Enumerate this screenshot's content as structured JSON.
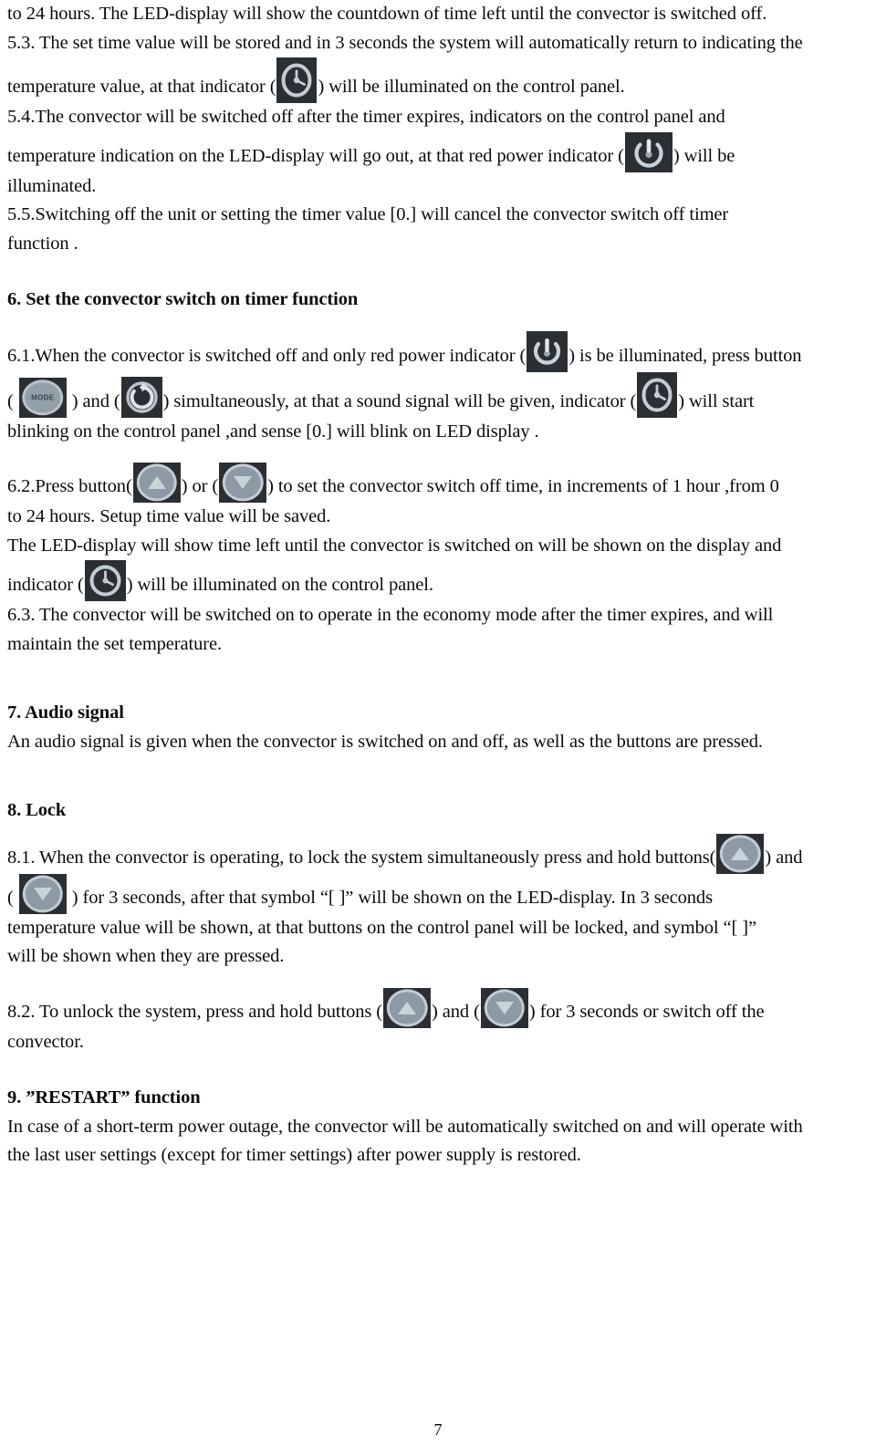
{
  "document": {
    "page_number": "7"
  },
  "icons": {
    "timer": "clock-timer-icon",
    "power": "power-icon",
    "mode": "mode-button-icon",
    "mode_label": "MODE",
    "restart": "restart-cycle-icon",
    "arrow_up": "arrow-up-button-icon",
    "arrow_down": "arrow-down-button-icon"
  },
  "colors": {
    "icon_background": "#2b2e33",
    "icon_glyph": "#c8d2d9",
    "icon_button_face": "#8d9aa5",
    "page_background": "#ffffff",
    "text": "#0b0b0b"
  },
  "body": {
    "p_top": "to 24 hours. The LED-display will show the countdown of time left until the convector is switched off.",
    "p_5_3_a": "5.3. The set time value will be stored and in 3 seconds the system will automatically return to indicating the",
    "p_5_3_b_pre": "temperature value, at that indicator (",
    "p_5_3_b_post": ") will be illuminated on the control panel.",
    "p_5_4_a": "5.4.The convector will be switched off after the timer expires, indicators on the control panel and",
    "p_5_4_b_pre": "temperature indication on the LED-display will go out, at that red power indicator (",
    "p_5_4_b_post": ") will be",
    "p_5_4_c": "illuminated.",
    "p_5_5_a": "5.5.Switching off the unit or setting the timer value   [0.] will cancel the convector switch off timer",
    "p_5_5_b": "function .",
    "h_6": "6. Set the convector switch on timer function",
    "p_6_1_a_pre": "6.1.When the convector is switched off and only red power indicator (",
    "p_6_1_a_post": ") is be illuminated, press button",
    "p_6_1_b_pre": "( ",
    "p_6_1_b_mid1": " ) and (",
    "p_6_1_b_mid2": ") simultaneously, at that a sound signal will be given, indicator (",
    "p_6_1_b_post": ") will start",
    "p_6_1_c": "blinking on the control panel ,and sense [0.]    will blink on LED display .",
    "p_6_2_pre": "6.2.Press button(",
    "p_6_2_mid": ") or (",
    "p_6_2_post": ") to set the convector switch off time, in increments of 1 hour ,from 0",
    "p_6_2_b": "to 24 hours. Setup time value will be saved.",
    "p_6_2_c": "The LED-display will show time left until the convector is switched on will be shown on the display and",
    "p_6_2_d_pre": "indicator (",
    "p_6_2_d_post": ") will be illuminated on the control panel.",
    "p_6_3_a": "6.3. The convector will be switched on to operate in the economy mode after the timer expires, and will",
    "p_6_3_b": "maintain the set temperature.",
    "h_7": "7. Audio signal",
    "p_7": "An audio signal is given when the convector is switched on and off, as well as the buttons are pressed.",
    "h_8": "8. Lock",
    "p_8_1_a_pre": "8.1. When the convector is operating, to lock the system simultaneously press and hold buttons(",
    "p_8_1_a_post": ") and",
    "p_8_1_b_pre": "( ",
    "p_8_1_b_post": " ) for 3 seconds, after that symbol “[   ]” will be shown on the LED-display. In 3 seconds",
    "p_8_1_c": "temperature value will be shown, at that buttons on the control panel will be locked, and symbol “[   ]”",
    "p_8_1_d": "will be shown when they are pressed.",
    "p_8_2_pre": "8.2. To unlock the system, press   and hold buttons (",
    "p_8_2_mid": ") and (",
    "p_8_2_post": ") for 3 seconds or switch off the",
    "p_8_2_b": "convector.",
    "h_9": "9. ”RESTART” function",
    "p_9_a": "In case of a short-term power outage, the convector will be automatically switched on and will operate with",
    "p_9_b": "the last user settings (except for timer settings) after   power supply is restored."
  }
}
